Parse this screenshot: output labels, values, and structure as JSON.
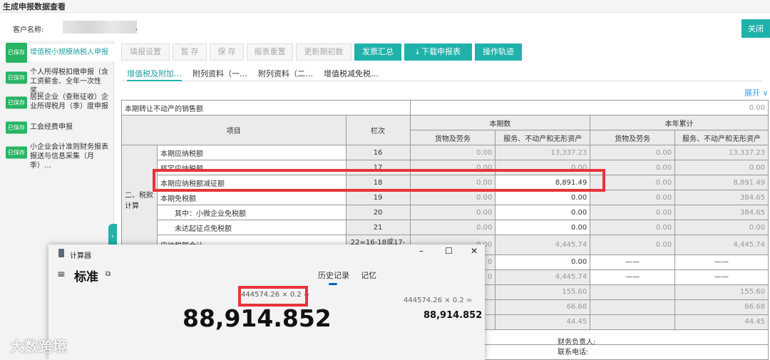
{
  "window": {
    "title": "生成申报数据查看"
  },
  "customer": {
    "label": "客户名称:",
    "suffix": "."
  },
  "close_label": "关闭",
  "sidebar": {
    "items": [
      {
        "badge": "已保存",
        "label": "增值税小规模纳税人申报"
      },
      {
        "badge": "已保存",
        "label": "个人所得税扣缴申报（含工资薪金、全年一次性奖…"
      },
      {
        "badge": "已保存",
        "label": "居民企业（查账征收）企业所得税月（季）度申报"
      },
      {
        "badge": "已保存",
        "label": "工会经费申报"
      },
      {
        "badge": "已保存",
        "label": "小企业会计准则财务报表报送与信息采集（月季）…"
      }
    ],
    "collapse_icon": "‹"
  },
  "toolbar": {
    "fill": "填报设置",
    "stage": "暂 存",
    "save": "保 存",
    "reset": "报表重置",
    "update": "更新期初数",
    "invoice": "发票汇总",
    "download": "下载申报表",
    "log": "操作轨迹",
    "download_icon": "⤓"
  },
  "tabs": [
    "增值税及附加…",
    "附列资料（一…",
    "附列资料（二…",
    "增值税减免税…"
  ],
  "expand": "展开 ∨",
  "table": {
    "top_row_label": "本期转让不动产的销售额",
    "top_row_value": "0.00",
    "h_item": "项目",
    "h_col": "栏次",
    "h_period": "本期数",
    "h_year": "本年累计",
    "h_goods": "货物及劳务",
    "h_service": "服务、不动产和无形资产",
    "section": "二、税款计算",
    "rows": [
      {
        "label": "本期应纳税额",
        "col": "16",
        "v1": "0.00",
        "v2": "13,337.23",
        "v3": "0.00",
        "v4": "13,337.23"
      },
      {
        "label": "核定应纳税额",
        "col": "17",
        "v1": "0.00",
        "v2": "0.00",
        "v3": "0.00",
        "v4": "0.00"
      },
      {
        "label": "本期应纳税额减征额",
        "col": "18",
        "v1": "0.00",
        "v2": "8,891.49",
        "v3": "0.00",
        "v4": "8,891.49"
      },
      {
        "label": "本期免税额",
        "col": "19",
        "v1": "0.00",
        "v2": "0.00",
        "v3": "0.00",
        "v4": "384.65"
      },
      {
        "label": "其中：小微企业免税额",
        "col": "20",
        "v1": "0.00",
        "v2": "0.00",
        "v3": "0.00",
        "v4": "384.65"
      },
      {
        "label": "未达起征点免税额",
        "col": "21",
        "v1": "0.00",
        "v2": "0.00",
        "v3": "0.00",
        "v4": "0.00"
      },
      {
        "label": "应纳税额合计",
        "col": "22=16-18或17-18",
        "v1": "0.00",
        "v2": "4,445.74",
        "v3": "0.00",
        "v4": "4,445.74"
      },
      {
        "label": "",
        "col": "",
        "v1": "0",
        "v2": "0.00",
        "v3": "——",
        "v4": "——"
      },
      {
        "label": "",
        "col": "",
        "v1": "0",
        "v2": "4,445.74",
        "v3": "——",
        "v4": "——"
      },
      {
        "label": "",
        "col": "",
        "v1": "",
        "v2": "155.60",
        "v3": "",
        "v4": "155.60"
      },
      {
        "label": "",
        "col": "",
        "v1": "",
        "v2": "66.68",
        "v3": "",
        "v4": "66.68"
      },
      {
        "label": "",
        "col": "",
        "v1": "",
        "v2": "44.45",
        "v3": "",
        "v4": "44.45"
      }
    ],
    "finance": "财务负责人:",
    "contact": "联系电话:"
  },
  "calculator": {
    "title": "计算器",
    "minimize": "–",
    "maximize": "☐",
    "close": "✕",
    "menu_icon": "≡",
    "mode": "标准",
    "keep_on_top_icon": "⧉",
    "history_tab": "历史记录",
    "memory_tab": "记忆",
    "expression": "444574.26 × 0.2 =",
    "result": "88,914.852",
    "history_expression": "444574.26  ×  0.2 =",
    "history_result": "88,914.852"
  },
  "watermark": "大数跨境"
}
